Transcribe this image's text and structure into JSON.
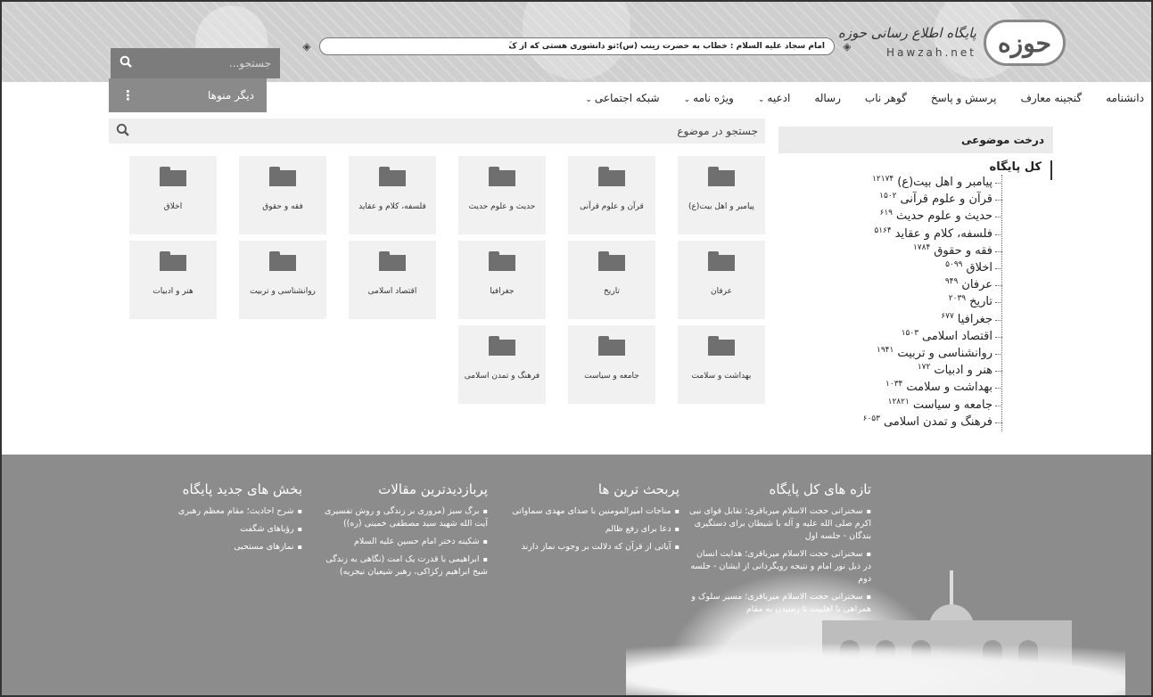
{
  "header": {
    "logo_mark": "حوزه",
    "logo_name": "پایگاه اطلاع رسانی حوزه",
    "logo_latin": "Hawzah.net",
    "ticker_text": "امام سجاد علیه السلام : خطاب به حضرت زینب (س):تو دانشوری هستی که از کَ",
    "search_placeholder": "جستجو...",
    "search_icon": "search-icon"
  },
  "nav": {
    "items": [
      {
        "label": "دانشنامه",
        "caret": ""
      },
      {
        "label": "گنجینه معارف",
        "caret": ""
      },
      {
        "label": "پرسش و پاسخ",
        "caret": ""
      },
      {
        "label": "گوهر ناب",
        "caret": ""
      },
      {
        "label": "رساله",
        "caret": ""
      },
      {
        "label": "ادعیه",
        "caret": "⌄"
      },
      {
        "label": "ویژه نامه",
        "caret": "⌄"
      },
      {
        "label": "شبکه اجتماعی",
        "caret": "⌄"
      }
    ],
    "more_label": "دیگر منوها",
    "more_icon": "⋮"
  },
  "content_search": {
    "placeholder": "جستجو در موضوع",
    "icon": "search-icon"
  },
  "folders": [
    "پیامبر و اهل بیت(ع)",
    "قرآن و علوم قرآنی",
    "حدیث و علوم حدیث",
    "فلسفه، کلام و عقاید",
    "فقه و حقوق",
    "اخلاق",
    "عرفان",
    "تاریخ",
    "جغرافیا",
    "اقتصاد اسلامی",
    "روانشناسی و تربیت",
    "هنر و ادبیات",
    "بهداشت و سلامت",
    "جامعه و سیاست",
    "فرهنگ و تمدن اسلامی"
  ],
  "tree": {
    "title": "درخت موضوعی",
    "root": "کل پایگاه",
    "items": [
      {
        "label": "پیامبر و اهل بیت(ع)",
        "count": "۱۲۱۷۴"
      },
      {
        "label": "قرآن و علوم قرآنی",
        "count": "۱۵۰۲"
      },
      {
        "label": "حدیث و علوم حدیث",
        "count": "۶۱۹"
      },
      {
        "label": "فلسفه، کلام و عقاید",
        "count": "۵۱۶۴"
      },
      {
        "label": "فقه و حقوق",
        "count": "۱۷۸۴"
      },
      {
        "label": "اخلاق",
        "count": "۵۰۹۹"
      },
      {
        "label": "عرفان",
        "count": "۹۴۹"
      },
      {
        "label": "تاریخ",
        "count": "۲۰۳۹"
      },
      {
        "label": "جغرافیا",
        "count": "۶۷۷"
      },
      {
        "label": "اقتصاد اسلامی",
        "count": "۱۵۰۳"
      },
      {
        "label": "روانشناسی و تربیت",
        "count": "۱۹۴۱"
      },
      {
        "label": "هنر و ادبیات",
        "count": "۱۷۲"
      },
      {
        "label": "بهداشت و سلامت",
        "count": "۱۰۳۴"
      },
      {
        "label": "جامعه و سیاست",
        "count": "۱۲۸۲۱"
      },
      {
        "label": "فرهنگ و تمدن اسلامی",
        "count": "۶۰۵۳"
      }
    ]
  },
  "footer": {
    "new_title": "تازه های کل پایگاه",
    "new_items": [
      "سخنرانی حجت الاسلام میرباقری؛ تقابل قوای نبی اکرم صلی الله علیه و آله با شیطان برای دستگیری بندگان - جلسه اول",
      "سخنرانی حجت الاسلام میرباقری؛ هدایت انسان در ذیل نور امام و نتیجه رویگردانی از ایشان - جلسه دوم",
      "سخنرانی حجت الاسلام میرباقری؛ مسیر سلوک و همراهی با اهلبیت تا رسیدن به مقام"
    ],
    "discussed_title": "پربحث ترین ها",
    "discussed_items": [
      "مناجات امیرالمومنین با صدای مهدی سماواتی",
      "دعا برای رفع ظالم",
      "آیاتی از قرآن که دلالت بر وجوب نماز دارند"
    ],
    "visited_title": "پربازدیدترین مقالات",
    "visited_items": [
      "برگ سبز (مروری بر زندگی و روش تفسیری آیت الله شهید سید مصطفی خمینی (ره))",
      "شکینه دختر امام حسین علیه السلام",
      "ابراهیمی با قدرت یک امت (نگاهی به زندگی شیخ ابراهیم زکزاکی، رهبر شیعیان نیجریه)"
    ],
    "sections_title": "بخش های جدید پایگاه",
    "sections_items": [
      "شرح احادیث؛ مقام معظم رهبری",
      "رؤیاهای شگفت",
      "نمازهای مستحبی"
    ]
  }
}
